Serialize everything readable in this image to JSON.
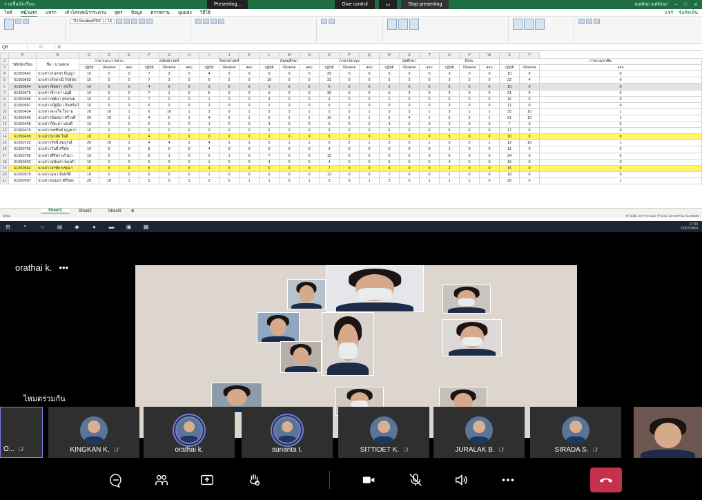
{
  "excel": {
    "title_left": "รายชื่อนักเรียน",
    "present_label": "Presenting...",
    "give_control": "Give control",
    "stop_presenting": "Stop presenting",
    "user": "orathai sutthisri",
    "ribbon_tabs": [
      "ไฟล์",
      "หน้าแรก",
      "แทรก",
      "เค้าโครงหน้ากระดาษ",
      "สูตร",
      "ข้อมูล",
      "ตรวจทาน",
      "มุมมอง",
      "วิธีใช้"
    ],
    "ribbon_right": [
      "แชร์",
      "ข้อคิดเห็น"
    ],
    "font_name": "TH SarabunPSK",
    "font_size": "16",
    "name_box": "Q6",
    "fx": "fx",
    "formula_value": "0",
    "col_letters": [
      "A",
      "B",
      "C",
      "D",
      "E",
      "F",
      "G",
      "H",
      "I",
      "J",
      "K",
      "L",
      "M",
      "N",
      "O",
      "P",
      "Q",
      "R",
      "S",
      "T",
      "U",
      "V",
      "W",
      "X",
      "Y"
    ],
    "group_headers": [
      "ภาษาและการอ่าน",
      "คณิตศาสตร์",
      "วิทยาศาสตร์",
      "สังคมศึกษา",
      "ภาษาอังกฤษ",
      "สุขศึกษา",
      "ศิลปะ",
      "การงานอาชีพ"
    ],
    "id_header": "รหัสนักเรียน",
    "name_header": "ชื่อ - นามสกุล",
    "sub_headers": [
      "ปฏิบัติ",
      "Observe",
      "สอบ"
    ],
    "rows": [
      {
        "n": "4",
        "id": "61050642",
        "name": "นางสาวกนกพร ปัญญา",
        "v": [
          "10",
          "0",
          "0",
          "7",
          "2",
          "0",
          "4",
          "0",
          "0",
          "6",
          "0",
          "0",
          "25",
          "0",
          "0",
          "5",
          "0",
          "0",
          "3",
          "0",
          "0",
          "10",
          "0",
          "0"
        ],
        "style": ""
      },
      {
        "n": "5",
        "id": "61050653",
        "name": "นางสาวกัลยาณี รักษ์สุข",
        "v": [
          "10",
          "0",
          "0",
          "7",
          "3",
          "0",
          "6",
          "2",
          "0",
          "10",
          "0",
          "0",
          "31",
          "0",
          "0",
          "5",
          "2",
          "0",
          "5",
          "2",
          "0",
          "22",
          "4",
          "0"
        ],
        "style": ""
      },
      {
        "n": "6",
        "id": "61050664",
        "name": "นางสาวจิตตรา สุขใจ",
        "v": [
          "10",
          "0",
          "0",
          "4",
          "0",
          "0",
          "0",
          "0",
          "0",
          "5",
          "0",
          "0",
          "5",
          "0",
          "0",
          "2",
          "0",
          "0",
          "5",
          "0",
          "0",
          "10",
          "0",
          "0"
        ],
        "style": "selected"
      },
      {
        "n": "7",
        "id": "61050675",
        "name": "นางสาวจิราภา บุญมี",
        "v": [
          "10",
          "0",
          "0",
          "7",
          "1",
          "0",
          "5",
          "2",
          "0",
          "6",
          "0",
          "0",
          "30",
          "0",
          "0",
          "5",
          "2",
          "0",
          "3",
          "0",
          "0",
          "21",
          "5",
          "0"
        ],
        "style": ""
      },
      {
        "n": "8",
        "id": "61050686",
        "name": "นางสาวชุติมา สุขเกษม",
        "v": [
          "10",
          "0",
          "0",
          "7",
          "0",
          "0",
          "1",
          "0",
          "0",
          "4",
          "0",
          "0",
          "4",
          "0",
          "0",
          "2",
          "0",
          "0",
          "5",
          "0",
          "0",
          "16",
          "0",
          "0"
        ],
        "style": ""
      },
      {
        "n": "9",
        "id": "61050697",
        "name": "นางสาวณัฐธิดา จันทร์แก้ว",
        "v": [
          "10",
          "0",
          "0",
          "6",
          "0",
          "0",
          "2",
          "0",
          "0",
          "1",
          "0",
          "0",
          "5",
          "0",
          "0",
          "5",
          "0",
          "0",
          "3",
          "0",
          "0",
          "11",
          "0",
          "0"
        ],
        "style": ""
      },
      {
        "n": "10",
        "id": "61050434",
        "name": "นางสาวดวงใจ ใจงาม",
        "v": [
          "20",
          "10",
          "1",
          "6",
          "10",
          "1",
          "2",
          "0",
          "1",
          "5",
          "3",
          "1",
          "5",
          "5",
          "1",
          "5",
          "5",
          "1",
          "5",
          "1",
          "1",
          "35",
          "10",
          "1"
        ],
        "style": ""
      },
      {
        "n": "11",
        "id": "61050456",
        "name": "นางสาวนันทนา ศรีวงศ์",
        "v": [
          "20",
          "10",
          "1",
          "4",
          "5",
          "1",
          "4",
          "2",
          "1",
          "5",
          "2",
          "1",
          "10",
          "5",
          "1",
          "5",
          "4",
          "1",
          "5",
          "2",
          "1",
          "21",
          "10",
          "1"
        ],
        "style": ""
      },
      {
        "n": "12",
        "id": "61050458",
        "name": "นางสาวปิยะดา ทองดี",
        "v": [
          "10",
          "0",
          "0",
          "6",
          "0",
          "0",
          "1",
          "0",
          "0",
          "4",
          "0",
          "0",
          "6",
          "0",
          "0",
          "4",
          "0",
          "0",
          "2",
          "0",
          "0",
          "7",
          "0",
          "0"
        ],
        "style": ""
      },
      {
        "n": "13",
        "id": "61050475",
        "name": "นางสาวพรทิพย์ บุญมาก",
        "v": [
          "10",
          "0",
          "0",
          "6",
          "0",
          "0",
          "0",
          "0",
          "0",
          "5",
          "2",
          "0",
          "9",
          "0",
          "0",
          "5",
          "0",
          "0",
          "5",
          "0",
          "0",
          "17",
          "0",
          "0"
        ],
        "style": ""
      },
      {
        "n": "14",
        "id": "61050499",
        "name": "นางสาวมาลัย ใจดี",
        "v": [
          "10",
          "2",
          "0",
          "4",
          "0",
          "0",
          "0",
          "0",
          "0",
          "2",
          "0",
          "0",
          "5",
          "2",
          "0",
          "5",
          "0",
          "0",
          "5",
          "0",
          "0",
          "10",
          "0",
          "0"
        ],
        "style": "yellow"
      },
      {
        "n": "15",
        "id": "61050722",
        "name": "นางสาวรัชนี สมบูรณ์",
        "v": [
          "20",
          "10",
          "1",
          "4",
          "4",
          "1",
          "4",
          "1",
          "1",
          "5",
          "1",
          "1",
          "5",
          "2",
          "1",
          "2",
          "5",
          "1",
          "5",
          "2",
          "1",
          "12",
          "10",
          "1"
        ],
        "style": ""
      },
      {
        "n": "16",
        "id": "61050750",
        "name": "นางสาววันดี ศรีสุข",
        "v": [
          "10",
          "0",
          "0",
          "8",
          "0",
          "0",
          "4",
          "0",
          "0",
          "6",
          "0",
          "0",
          "9",
          "0",
          "0",
          "6",
          "0",
          "0",
          "1",
          "0",
          "0",
          "11",
          "0",
          "0"
        ],
        "style": ""
      },
      {
        "n": "17",
        "id": "61050760",
        "name": "นางสาวศิริพร แก้วมา",
        "v": [
          "10",
          "0",
          "0",
          "6",
          "1",
          "0",
          "2",
          "1",
          "0",
          "7",
          "0",
          "0",
          "15",
          "0",
          "0",
          "5",
          "0",
          "0",
          "6",
          "0",
          "0",
          "24",
          "0",
          "0"
        ],
        "style": ""
      },
      {
        "n": "18",
        "id": "61050562",
        "name": "นางสาวสุนันทา ทองคำ",
        "v": [
          "10",
          "0",
          "0",
          "5",
          "0",
          "0",
          "1",
          "0",
          "0",
          "4",
          "0",
          "0",
          "4",
          "0",
          "0",
          "5",
          "0",
          "0",
          "4",
          "0",
          "0",
          "16",
          "0",
          "0"
        ],
        "style": ""
      },
      {
        "n": "19",
        "id": "61050564",
        "name": "นางสาวอรทัย พรมมา",
        "v": [
          "10",
          "0",
          "0",
          "5",
          "0",
          "0",
          "0",
          "0",
          "0",
          "6",
          "0",
          "0",
          "7",
          "0",
          "0",
          "6",
          "0",
          "0",
          "2",
          "0",
          "0",
          "15",
          "0",
          "0"
        ],
        "style": "yellow"
      },
      {
        "n": "20",
        "id": "61050575",
        "name": "นางสาวอุษา จันทร์ดี",
        "v": [
          "10",
          "0",
          "0",
          "6",
          "0",
          "0",
          "1",
          "0",
          "0",
          "6",
          "0",
          "0",
          "12",
          "0",
          "0",
          "7",
          "0",
          "0",
          "2",
          "0",
          "0",
          "18",
          "0",
          "0"
        ],
        "style": ""
      },
      {
        "n": "21",
        "id": "61050597",
        "name": "นางสาวเอมอร ศรีทอง",
        "v": [
          "20",
          "10",
          "1",
          "5",
          "0",
          "1",
          "2",
          "0",
          "1",
          "1",
          "0",
          "1",
          "2",
          "0",
          "1",
          "2",
          "0",
          "1",
          "1",
          "1",
          "0",
          "25",
          "0",
          "1"
        ],
        "style": ""
      }
    ],
    "sheet_tabs": [
      "Sheet1",
      "Sheet2",
      "Sheet3"
    ],
    "status_left": "พร้อม",
    "status_right": "ค่าเฉลี่ย: 357779.3333   จำนวน: 107   ผลรวม: 61050680"
  },
  "taskbar": {
    "clock_time": "17:34",
    "clock_date": "22/07/2564"
  },
  "meeting": {
    "presenter_name": "orathai k.",
    "presenter_more": "•••",
    "gallery_label": "ไหมดร่วมกัน",
    "participants": [
      {
        "name": "O...",
        "muted": true
      },
      {
        "name": "KINGKAN K.",
        "muted": true
      },
      {
        "name": "orathai k.",
        "muted": false,
        "ring": true
      },
      {
        "name": "sunanta t.",
        "muted": false,
        "ring": true
      },
      {
        "name": "SITTIDET K.",
        "muted": true
      },
      {
        "name": "JURALAK B.",
        "muted": true
      },
      {
        "name": "SIRADA S.",
        "muted": true
      }
    ],
    "colors": {
      "hangup": "#c4314b",
      "speaking_ring": "#6d7fe0",
      "excel_green": "#1e6e42",
      "highlight_yellow": "#fff566"
    }
  }
}
